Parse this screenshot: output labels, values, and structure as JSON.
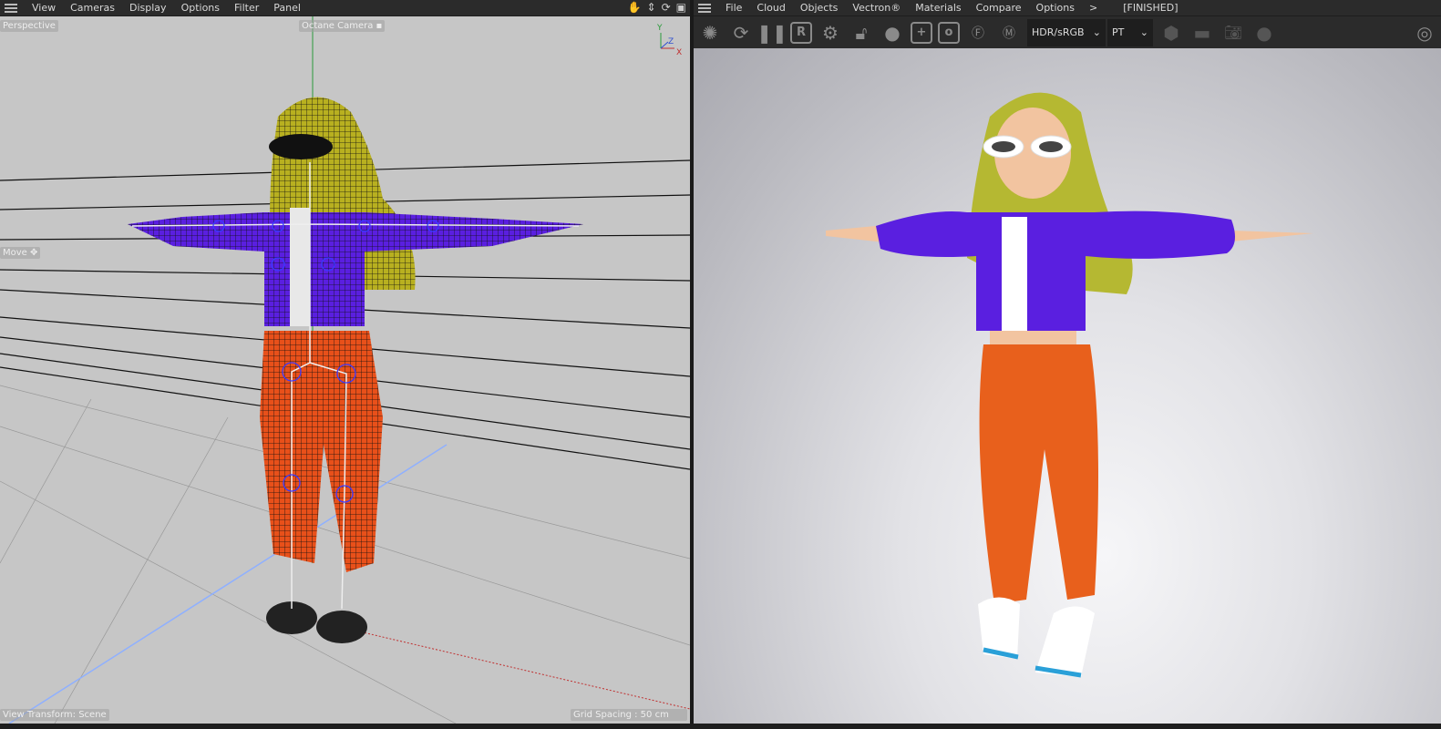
{
  "left_viewport": {
    "menu": [
      "View",
      "Cameras",
      "Display",
      "Options",
      "Filter",
      "Panel"
    ],
    "nav_icons": [
      "hand-icon",
      "move-arrows-icon",
      "rotate-icon",
      "maximize-icon"
    ],
    "view_name": "Perspective",
    "camera_name": "Octane Camera",
    "tool_label": "Move",
    "view_transform": "View Transform: Scene",
    "grid_spacing": "Grid Spacing : 50 cm",
    "axes": {
      "y": "Y",
      "z": "Z",
      "x": "X"
    }
  },
  "right_viewport": {
    "menu": [
      "File",
      "Cloud",
      "Objects",
      "Vectron®",
      "Materials",
      "Compare",
      "Options",
      ">"
    ],
    "status": "[FINISHED]",
    "toolbar_icons": [
      "octane-logo-icon",
      "restart-icon",
      "pause-icon",
      "region-r-icon",
      "settings-gear-icon",
      "lock-icon",
      "material-sphere-icon",
      "add-box-icon",
      "object-box-icon",
      "focus-f-icon",
      "material-m-icon"
    ],
    "color_space": "HDR/sRGB",
    "kernel": "PT",
    "extra_icons": [
      "hexagon-icon",
      "rectangle-icon",
      "camera-icon",
      "circle-icon",
      "power-icon"
    ]
  },
  "colors": {
    "jacket": "#5a1fe0",
    "pants": "#e8601c",
    "hair": "#b8b830",
    "skin": "#f2c4a0"
  }
}
